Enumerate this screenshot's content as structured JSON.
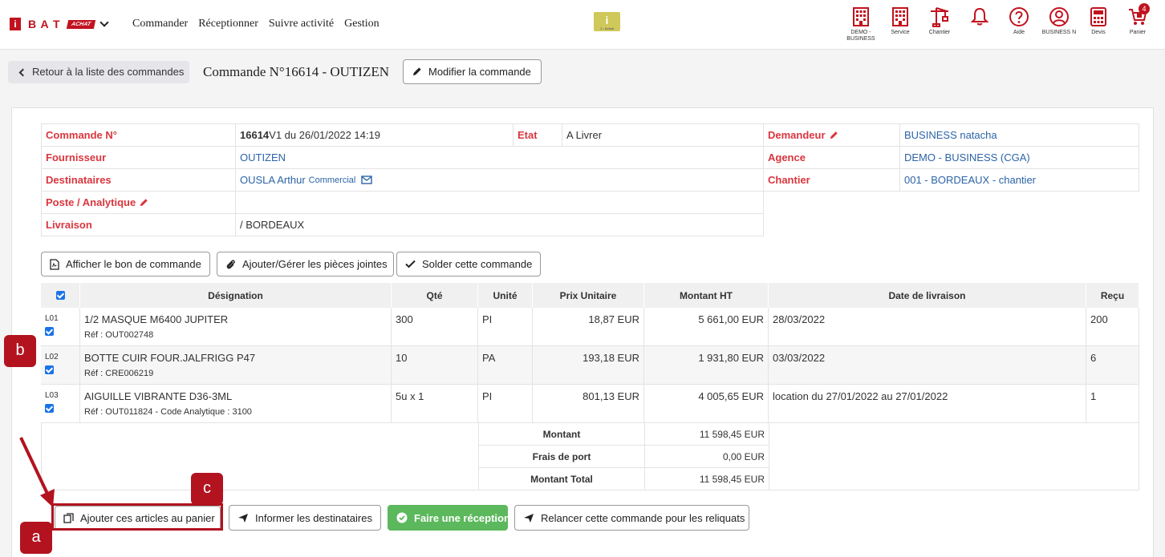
{
  "topbar": {
    "logo_letter_i": "i",
    "logo_bat": "B A T",
    "logo_achat": "ACHAT",
    "nav": [
      "Commander",
      "Réceptionner",
      "Suivre activité",
      "Gestion"
    ],
    "center_badge": "i",
    "center_badge_sub": "1 : Achat",
    "icons": [
      {
        "name": "building-icon",
        "label": "DEMO - BUSINESS"
      },
      {
        "name": "building-icon",
        "label": "Service"
      },
      {
        "name": "crane-icon",
        "label": "Chantier"
      },
      {
        "name": "bell-icon",
        "label": ""
      },
      {
        "name": "help-icon",
        "label": "Aide"
      },
      {
        "name": "user-icon",
        "label": "BUSINESS N"
      },
      {
        "name": "calculator-icon",
        "label": "Devis"
      },
      {
        "name": "cart-icon",
        "label": "Panier"
      }
    ],
    "cart_count": "4",
    "accent": "#c1121f"
  },
  "header": {
    "back_label": "Retour à la liste des commandes",
    "order_title": "Commande N°16614 - OUTIZEN",
    "edit_label": "Modifier la commande"
  },
  "info": {
    "commande_label": "Commande N°",
    "commande_num": "16614",
    "commande_rest": " V1 du 26/01/2022 14:19",
    "etat_label": "Etat",
    "etat_value": "A Livrer",
    "demandeur_label": "Demandeur",
    "demandeur_value": "BUSINESS natacha",
    "fournisseur_label": "Fournisseur",
    "fournisseur_value": "OUTIZEN",
    "agence_label": "Agence",
    "agence_value": "DEMO - BUSINESS (CGA)",
    "destinataires_label": "Destinataires",
    "destinataires_value": "OUSLA Arthur",
    "destinataires_role": "Commercial",
    "chantier_label": "Chantier",
    "chantier_value": "001 - BORDEAUX - chantier",
    "poste_label": "Poste / Analytique",
    "livraison_label": "Livraison",
    "livraison_value": "/ BORDEAUX"
  },
  "actions": {
    "afficher": "Afficher le bon de commande",
    "pieces": "Ajouter/Gérer les pièces jointes",
    "solder": "Solder cette commande"
  },
  "table": {
    "headers": [
      "Désignation",
      "Qté",
      "Unité",
      "Prix Unitaire",
      "Montant HT",
      "Date de livraison",
      "Reçu"
    ],
    "rows": [
      {
        "line": "L01",
        "designation": "1/2 MASQUE M6400 JUPITER",
        "ref": "Réf : OUT002748",
        "qte": "300",
        "unite": "PI",
        "prix": "18,87 EUR",
        "montant": "5 661,00 EUR",
        "date": "28/03/2022",
        "recu": "200"
      },
      {
        "line": "L02",
        "designation": "BOTTE CUIR FOUR.JALFRIGG P47",
        "ref": "Réf : CRE006219",
        "qte": "10",
        "unite": "PA",
        "prix": "193,18 EUR",
        "montant": "1 931,80 EUR",
        "date": "03/03/2022",
        "recu": "6"
      },
      {
        "line": "L03",
        "designation": "AIGUILLE VIBRANTE D36-3ML",
        "ref": "Réf : OUT011824 - Code Analytique : 3100",
        "qte": "5u x 1",
        "unite": "PI",
        "prix": "801,13 EUR",
        "montant": "4 005,65 EUR",
        "date": "location du 27/01/2022 au 27/01/2022",
        "recu": "1"
      }
    ],
    "totals": [
      {
        "label": "Montant",
        "value": "11 598,45 EUR"
      },
      {
        "label": "Frais de port",
        "value": "0,00 EUR"
      },
      {
        "label": "Montant Total",
        "value": "11 598,45 EUR"
      }
    ]
  },
  "bottom": {
    "ajouter": "Ajouter ces articles au panier",
    "informer": "Informer les destinataires",
    "reception": "Faire une réception",
    "relancer": "Relancer cette commande pour les reliquats",
    "reception_color": "#5cb85c"
  },
  "markers": {
    "a": "a",
    "b": "b",
    "c": "c",
    "color": "#b3121f"
  }
}
